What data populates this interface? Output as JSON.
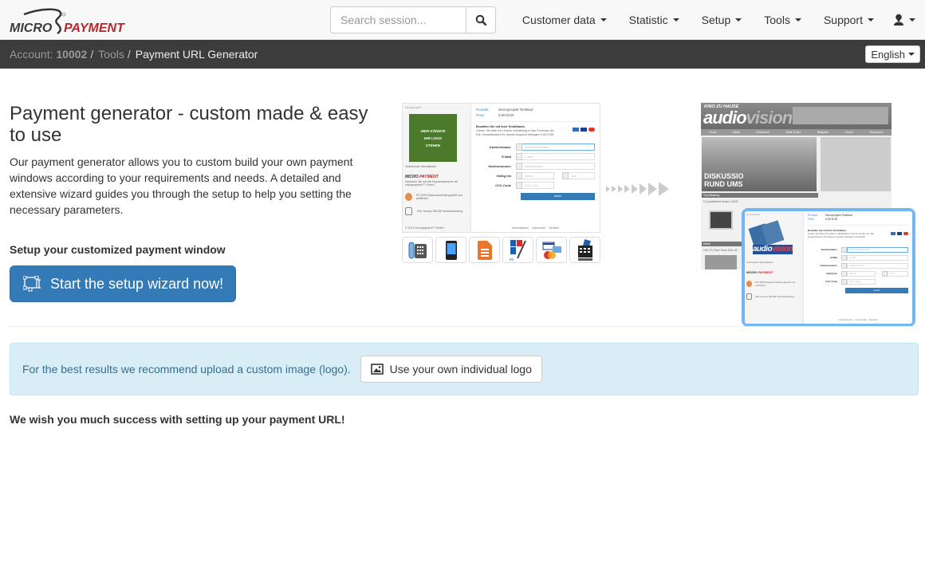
{
  "navbar": {
    "logo": {
      "left": "MICRO",
      "right": "PAYMENT",
      "icon": "micropayment-logo"
    },
    "search": {
      "placeholder": "Search session...",
      "value": "",
      "button_icon": "search-icon"
    },
    "menu": [
      {
        "label": "Customer data",
        "icon": "caret-down-icon"
      },
      {
        "label": "Statistic",
        "icon": "caret-down-icon"
      },
      {
        "label": "Setup",
        "icon": "caret-down-icon"
      },
      {
        "label": "Tools",
        "icon": "caret-down-icon"
      },
      {
        "label": "Support",
        "icon": "caret-down-icon"
      }
    ],
    "user_icon": "user-icon"
  },
  "breadcrumb": {
    "account_label": "Account:",
    "account_number": "10002",
    "items": [
      "Tools",
      "Payment URL Generator"
    ],
    "separator": "/",
    "language": "English"
  },
  "intro": {
    "title": "Payment generator - custom made & easy to use",
    "description": "Our payment generator allows you to custom build your own payment windows according to your requirements and needs. A detailed and extensive wizard guides you through the setup to help you setting the necessary parameters.",
    "setup_label": "Setup your customized payment window",
    "wizard_button": "Start the setup wizard now!",
    "wizard_icon": "vector-path-icon"
  },
  "preview": {
    "demo_label": "Demoprojekt",
    "logo_placeholder": [
      "HIER KÖNNTE",
      "IHR LOGO",
      "STEHEN"
    ],
    "tech_provider": "Technischer Dienstleister:",
    "mp_text": "Vertrauen Sie auf die Paymentsysteme der micropayment™ GmbH.",
    "pci_text": "PCI DSS Datensicherheit geprüft und zertifiziert",
    "ssl_text": "SSL Secure 256-Bit Verschlüsselung",
    "copyright": "© 2017 micropayment™ GmbH",
    "product_label": "Produkt",
    "product_value": "Demoprojekt Testkauf",
    "price_label": "Preis",
    "price_value": "0,50 EUR",
    "pay_title": "Bezahlen Sie mit Ihrer Kreditkarte.",
    "pay_text": "Geben Sie bitte Ihre Daten vollständig in das Formular ein. Die Gesamtkosten für dieses Angebot betragen 0,50 EUR.",
    "fields": [
      {
        "label": "Karteninhaber",
        "placeholder": "Kreditkarteninhaber"
      },
      {
        "label": "E-Mail",
        "placeholder": "E-Mail"
      },
      {
        "label": "Kartennummer",
        "placeholder": "Kartennummer"
      },
      {
        "label": "Gültig bis",
        "placeholder": "Monat"
      },
      {
        "label": "CVC-Code",
        "placeholder": "CVC-Code"
      }
    ],
    "year_placeholder": "Jahr",
    "submit": "weiter",
    "footer": [
      "Informationen",
      "Impressum",
      "Deutsch"
    ],
    "payment_methods": [
      "phone-payment-icon",
      "mobile-payment-icon",
      "invoice-icon",
      "ec-debit-icon",
      "credit-card-icon",
      "prepaid-card-icon"
    ]
  },
  "embedded_site": {
    "kicker": "KINO ZU HAUSE",
    "logo_a": "audio",
    "logo_b": "vision",
    "nav": [
      "Home",
      "News",
      "Showroom",
      "Hefte & Abo",
      "Ratgeber",
      "Forum",
      "Test-Archiv"
    ],
    "hero": [
      "DISKUSSIO",
      "RUND UMS"
    ],
    "section_top": "Top-Meldung",
    "top_headline": "LG präsentiert ersten OLED",
    "section_news": "News",
    "news_headline": "LED-TV-Test: Sony KDL-40"
  },
  "alert": {
    "text": "For the best results we recommend upload a custom image (logo).",
    "button": "Use your own individual logo",
    "button_icon": "picture-icon"
  },
  "closing": "We wish you much success with setting up your payment URL!"
}
